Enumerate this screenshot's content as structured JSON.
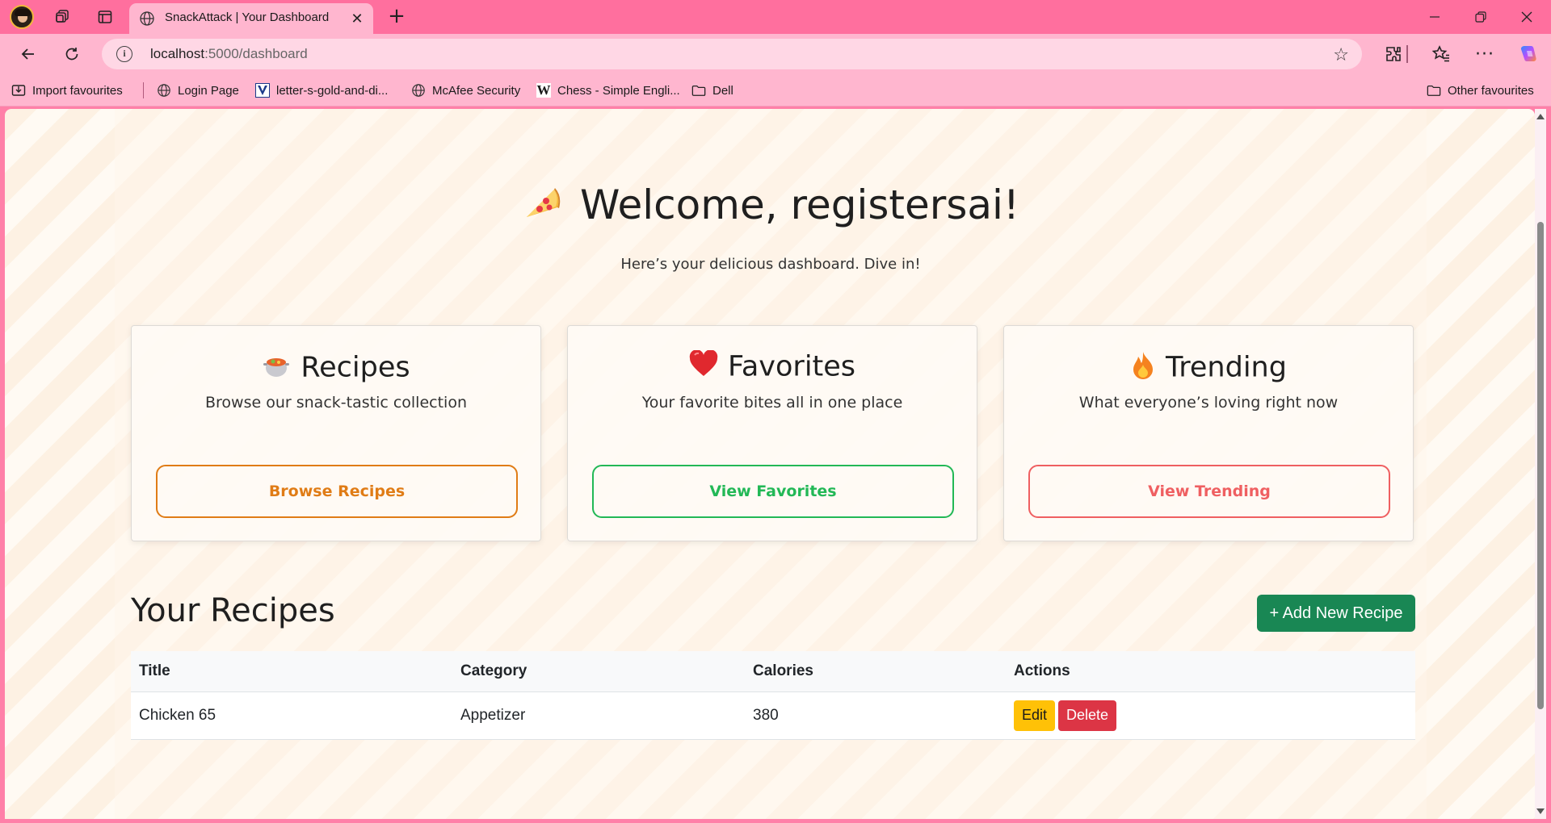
{
  "browser": {
    "tab_title": "SnackAttack | Your Dashboard",
    "address": {
      "host": "localhost",
      "path": ":5000/dashboard"
    },
    "bookmarks": [
      {
        "label": "Import favourites",
        "icon": "import-icon"
      },
      {
        "label": "Login Page",
        "icon": "globe-icon"
      },
      {
        "label": "letter-s-gold-and-di...",
        "icon": "v-logo-icon"
      },
      {
        "label": "McAfee Security",
        "icon": "globe-icon"
      },
      {
        "label": "Chess - Simple Engli...",
        "icon": "wikipedia-icon"
      },
      {
        "label": "Dell",
        "icon": "folder-icon"
      }
    ],
    "other_favourites": "Other favourites"
  },
  "hero": {
    "title": "Welcome, registersai!",
    "subtitle": "Here’s your delicious dashboard. Dive in!",
    "icon": "pizza-icon"
  },
  "cards": [
    {
      "title": "Recipes",
      "icon": "stew-pot-icon",
      "description": "Browse our snack-tastic collection",
      "button": "Browse Recipes",
      "color": "#e07c16"
    },
    {
      "title": "Favorites",
      "icon": "heart-icon",
      "description": "Your favorite bites all in one place",
      "button": "View Favorites",
      "color": "#22b856"
    },
    {
      "title": "Trending",
      "icon": "fire-icon",
      "description": "What everyone’s loving right now",
      "button": "View Trending",
      "color": "#ef5f61"
    }
  ],
  "recipes": {
    "title": "Your Recipes",
    "add_button": "+ Add New Recipe",
    "columns": [
      "Title",
      "Category",
      "Calories",
      "Actions"
    ],
    "rows": [
      {
        "title": "Chicken 65",
        "category": "Appetizer",
        "calories": "380",
        "edit": "Edit",
        "delete": "Delete"
      }
    ]
  }
}
